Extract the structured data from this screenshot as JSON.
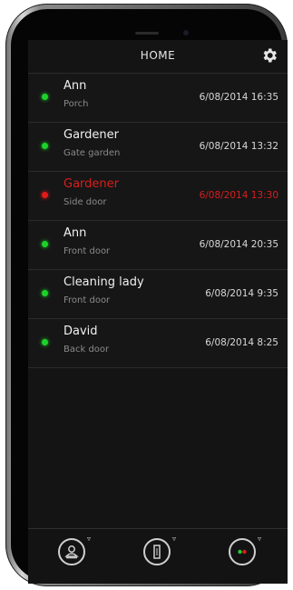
{
  "header": {
    "title": "HOME",
    "settings_icon": "gear-icon"
  },
  "events": [
    {
      "name": "Ann",
      "location": "Porch",
      "time": "6/08/2014 16:35",
      "status_color": "#1ed12a"
    },
    {
      "name": "Gardener",
      "location": "Gate garden",
      "time": "6/08/2014 13:32",
      "status_color": "#1ed12a"
    },
    {
      "name": "Gardener",
      "location": "Side door",
      "time": "6/08/2014 13:30",
      "status_color": "#e11a1a",
      "alarm": true
    },
    {
      "name": "Ann",
      "location": "Front door",
      "time": "6/08/2014 20:35",
      "status_color": "#1ed12a"
    },
    {
      "name": "Cleaning lady",
      "location": "Front door",
      "time": "6/08/2014 9:35",
      "status_color": "#1ed12a"
    },
    {
      "name": "David",
      "location": "Back door",
      "time": "6/08/2014  8:25",
      "status_color": "#1ed12a"
    }
  ],
  "toolbar": {
    "items": [
      {
        "icon": "person-badge-icon"
      },
      {
        "icon": "door-icon"
      },
      {
        "icon": "status-dots-icon"
      }
    ]
  },
  "colors": {
    "ok": "#1ed12a",
    "alarm": "#e11a1a",
    "background": "#141414"
  }
}
